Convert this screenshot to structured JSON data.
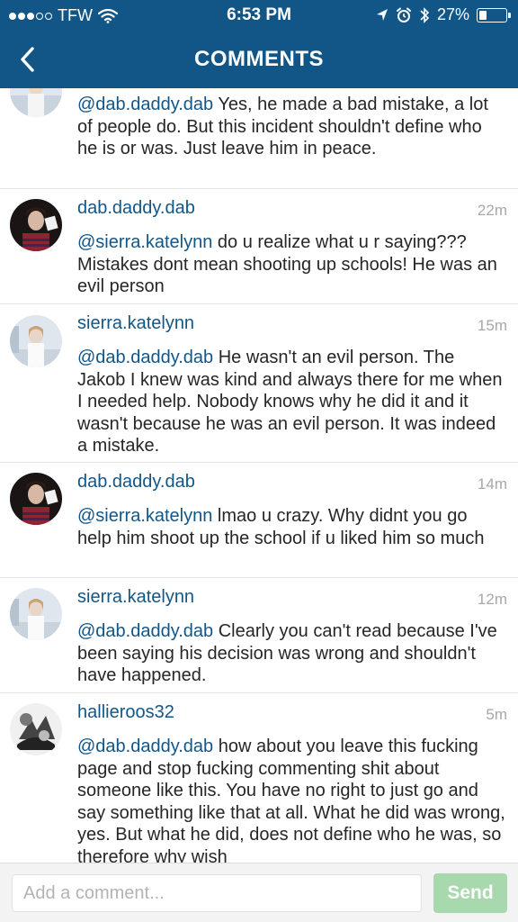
{
  "status_bar": {
    "carrier": "TFW",
    "time": "6:53 PM",
    "battery_percent_label": "27%",
    "battery_level": 0.27
  },
  "nav": {
    "title": "COMMENTS",
    "back_icon": "chevron-left-icon"
  },
  "comments": [
    {
      "username": "",
      "time": "",
      "mention": "@dab.daddy.dab",
      "text": " Yes, he made a bad mistake, a lot of people do. But this incident shouldn't define who he is or was. Just leave him in peace."
    },
    {
      "username": "dab.daddy.dab",
      "time": "22m",
      "mention": "@sierra.katelynn",
      "text": " do u realize what u r saying??? Mistakes dont mean shooting up schools! He was an evil person"
    },
    {
      "username": "sierra.katelynn",
      "time": "15m",
      "mention": "@dab.daddy.dab",
      "text": " He wasn't an evil person. The Jakob I knew was kind and always there for me when I needed help. Nobody knows why he did it and it wasn't because he was an evil person. It was indeed a mistake."
    },
    {
      "username": "dab.daddy.dab",
      "time": "14m",
      "mention": "@sierra.katelynn",
      "text": " lmao u crazy. Why didnt you go help him shoot up the school if u liked him so much"
    },
    {
      "username": "sierra.katelynn",
      "time": "12m",
      "mention": "@dab.daddy.dab",
      "text": " Clearly you can't read because I've been saying his decision was wrong and shouldn't have happened."
    },
    {
      "username": "hallieroos32",
      "time": "5m",
      "mention": "@dab.daddy.dab",
      "text": " how about you leave this fucking page and stop fucking commenting shit about someone like this. You have no right to just go and say something like that at all. What he did was wrong, yes. But what he did, does not define who he was, so therefore why wish"
    }
  ],
  "footer": {
    "placeholder": "Add a comment...",
    "send_label": "Send"
  },
  "colors": {
    "brand": "#125688",
    "send_disabled": "#a8d8ae",
    "time": "#a5a7aa"
  }
}
